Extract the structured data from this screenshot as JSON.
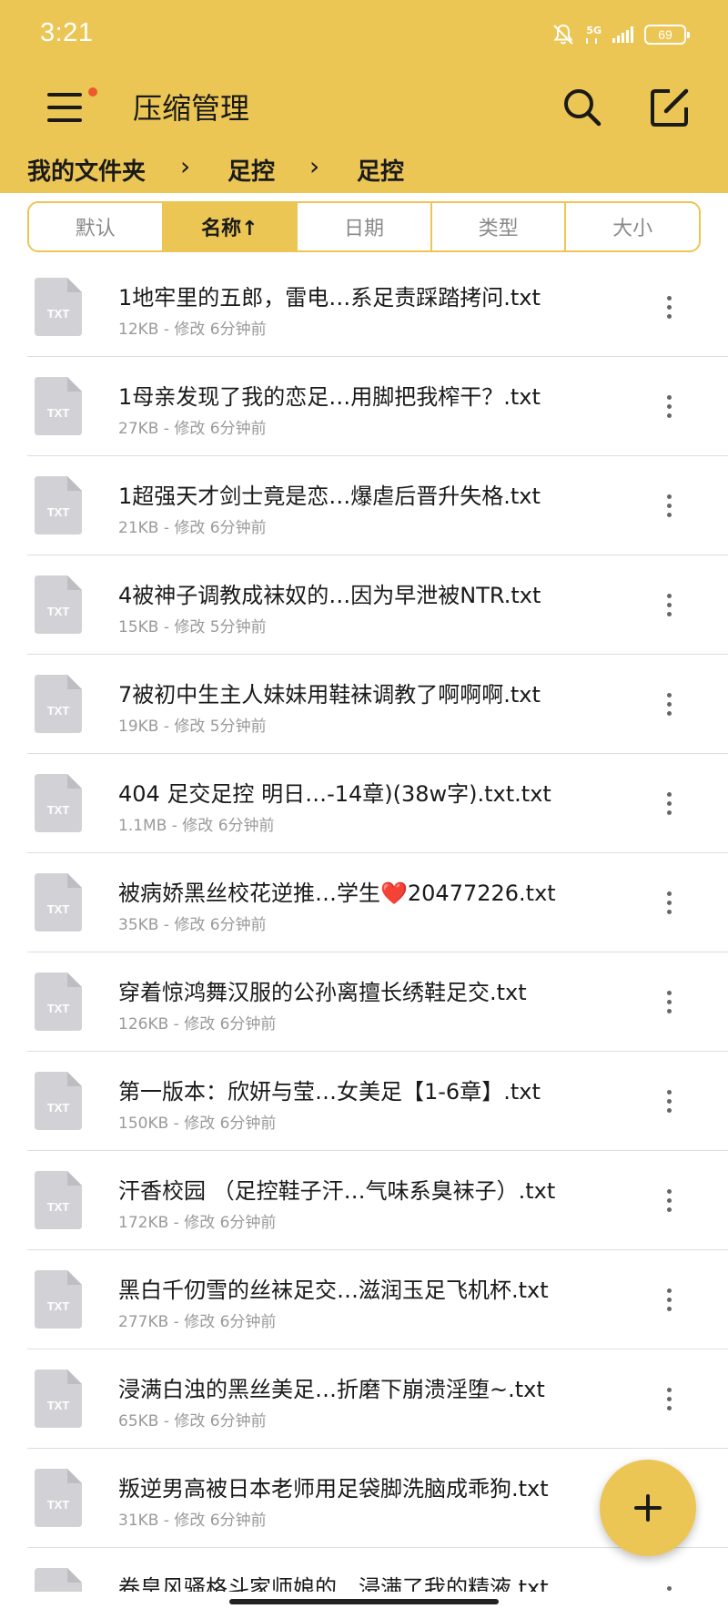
{
  "status_bar": {
    "time": "3:21",
    "network": "5G",
    "battery": "69"
  },
  "app_bar": {
    "title": "压缩管理"
  },
  "breadcrumb": {
    "items": [
      "我的文件夹",
      "足控",
      "足控"
    ],
    "separator": "›"
  },
  "sort_tabs": [
    {
      "label": "默认",
      "active": false
    },
    {
      "label": "名称↑",
      "active": true
    },
    {
      "label": "日期",
      "active": false
    },
    {
      "label": "类型",
      "active": false
    },
    {
      "label": "大小",
      "active": false
    }
  ],
  "file_type_label": "TXT",
  "files": [
    {
      "name": "1地牢里的五郎，雷电…系足责踩踏拷问.txt",
      "meta": "12KB - 修改 6分钟前"
    },
    {
      "name": "1母亲发现了我的恋足…用脚把我榨干？.txt",
      "meta": "27KB - 修改 6分钟前"
    },
    {
      "name": "1超强天才剑士竟是恋…爆虐后晋升失格.txt",
      "meta": "21KB - 修改 6分钟前"
    },
    {
      "name": "4被神子调教成袜奴的…因为早泄被NTR.txt",
      "meta": "15KB - 修改 5分钟前"
    },
    {
      "name": "7被初中生主人妹妹用鞋袜调教了啊啊啊.txt",
      "meta": "19KB - 修改 5分钟前"
    },
    {
      "name": "404  足交足控  明日…-14章)(38w字).txt.txt",
      "meta": "1.1MB - 修改 6分钟前"
    },
    {
      "name": "被病娇黑丝校花逆推…学生❤️20477226.txt",
      "meta": "35KB - 修改 6分钟前"
    },
    {
      "name": "穿着惊鸿舞汉服的公孙离擅长绣鞋足交.txt",
      "meta": "126KB - 修改 6分钟前"
    },
    {
      "name": "第一版本：欣妍与莹…女美足【1-6章】.txt",
      "meta": "150KB - 修改 6分钟前"
    },
    {
      "name": "汗香校园 （足控鞋子汗…气味系臭袜子）.txt",
      "meta": "172KB - 修改 6分钟前"
    },
    {
      "name": "黑白千仞雪的丝袜足交…滋润玉足飞机杯.txt",
      "meta": "277KB - 修改 6分钟前"
    },
    {
      "name": "浸满白浊的黑丝美足…折磨下崩溃淫堕~.txt",
      "meta": "65KB - 修改 6分钟前"
    },
    {
      "name": "叛逆男高被日本老师用足袋脚洗脑成乖狗.txt",
      "meta": "31KB - 修改 6分钟前"
    },
    {
      "name": "卷皇风骚格斗家师娘的…浸满了我的精液.txt",
      "meta": ""
    }
  ],
  "colors": {
    "accent": "#ecc655",
    "notification_dot": "#ec5a2c",
    "icon_gray": "#d2d2d6"
  },
  "icons": [
    "menu-icon",
    "search-icon",
    "edit-icon",
    "more-vert-icon",
    "plus-icon",
    "txt-file-icon"
  ]
}
